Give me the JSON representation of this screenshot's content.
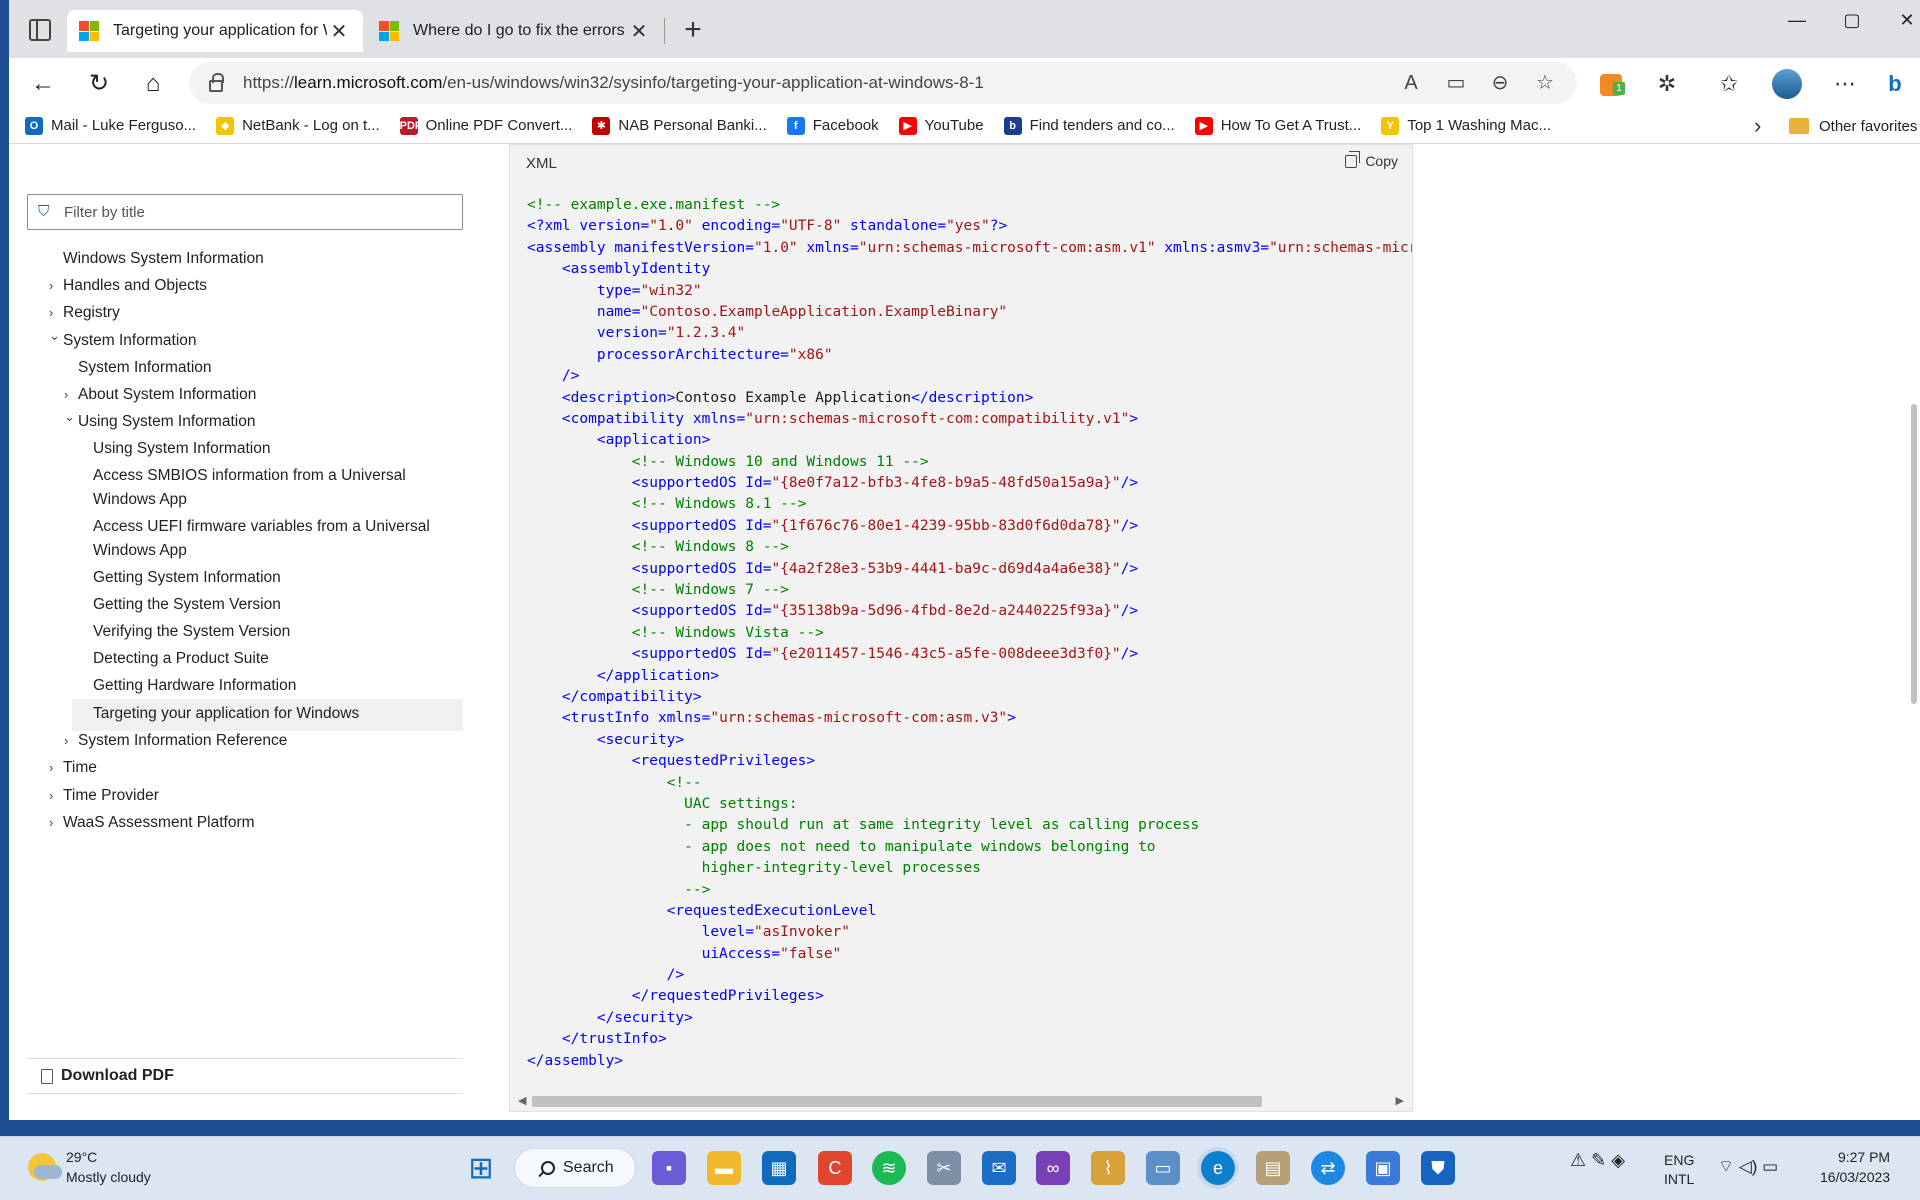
{
  "browser": {
    "tabs": [
      {
        "title": "Targeting your application for Wi",
        "active": true
      },
      {
        "title": "Where do I go to fix the errors on",
        "active": false
      }
    ],
    "new_tab": "+",
    "window_controls": {
      "minimize": "—",
      "maximize": "▢",
      "close": "✕"
    },
    "url": {
      "scheme": "https://",
      "host": "learn.microsoft.com",
      "path": "/en-us/windows/win32/sysinfo/targeting-your-application-at-windows-8-1"
    },
    "extension_badge": "1"
  },
  "bookmarks": [
    {
      "label": "Mail - Luke Ferguso...",
      "icon": "outlook-icon",
      "color": "#0f6cbd",
      "glyph": "O"
    },
    {
      "label": "NetBank - Log on t...",
      "icon": "commbank-icon",
      "color": "#f5c400",
      "glyph": "◆"
    },
    {
      "label": "Online PDF Convert...",
      "icon": "pdf-icon",
      "color": "#c0182b",
      "glyph": "PDF"
    },
    {
      "label": "NAB Personal Banki...",
      "icon": "nab-icon",
      "color": "#c20000",
      "glyph": "✱"
    },
    {
      "label": "Facebook",
      "icon": "facebook-icon",
      "color": "#1877f2",
      "glyph": "f"
    },
    {
      "label": "YouTube",
      "icon": "youtube-icon",
      "color": "#ff0000",
      "glyph": "▶"
    },
    {
      "label": "Find tenders and co...",
      "icon": "tenders-icon",
      "color": "#1a3d8f",
      "glyph": "b"
    },
    {
      "label": "How To Get A Trust...",
      "icon": "youtube-icon",
      "color": "#ff0000",
      "glyph": "▶"
    },
    {
      "label": "Top 1 Washing Mac...",
      "icon": "yellowpages-icon",
      "color": "#f2c500",
      "glyph": "Y"
    }
  ],
  "bookmarks_more": "›",
  "other_favorites": "Other favorites",
  "toc": {
    "filter_placeholder": "Filter by title",
    "items": [
      {
        "label": "Windows System Information",
        "level": 0,
        "chevron": ""
      },
      {
        "label": "Handles and Objects",
        "level": 0,
        "chevron": "›"
      },
      {
        "label": "Registry",
        "level": 0,
        "chevron": "›"
      },
      {
        "label": "System Information",
        "level": 0,
        "chevron": "⌄"
      },
      {
        "label": "System Information",
        "level": 1,
        "chevron": ""
      },
      {
        "label": "About System Information",
        "level": 1,
        "chevron": "›"
      },
      {
        "label": "Using System Information",
        "level": 1,
        "chevron": "⌄"
      },
      {
        "label": "Using System Information",
        "level": 2,
        "chevron": ""
      },
      {
        "label": "Access SMBIOS information from a Universal",
        "level": 2,
        "chevron": ""
      },
      {
        "label": "Windows App",
        "level": 2,
        "chevron": ""
      },
      {
        "label": "Access UEFI firmware variables from a Universal",
        "level": 2,
        "chevron": ""
      },
      {
        "label": "Windows App",
        "level": 2,
        "chevron": ""
      },
      {
        "label": "Getting System Information",
        "level": 2,
        "chevron": ""
      },
      {
        "label": "Getting the System Version",
        "level": 2,
        "chevron": ""
      },
      {
        "label": "Verifying the System Version",
        "level": 2,
        "chevron": ""
      },
      {
        "label": "Detecting a Product Suite",
        "level": 2,
        "chevron": ""
      },
      {
        "label": "Getting Hardware Information",
        "level": 2,
        "chevron": ""
      },
      {
        "label": "Targeting your application for Windows",
        "level": 2,
        "chevron": "",
        "selected": true
      },
      {
        "label": "System Information Reference",
        "level": 1,
        "chevron": "›"
      },
      {
        "label": "Time",
        "level": 0,
        "chevron": "›"
      },
      {
        "label": "Time Provider",
        "level": 0,
        "chevron": "›"
      },
      {
        "label": "WaaS Assessment Platform",
        "level": 0,
        "chevron": "›"
      }
    ],
    "download_pdf": "Download PDF"
  },
  "code_block": {
    "language": "XML",
    "copy_label": "Copy",
    "colors": {
      "comment": "#008000",
      "tag": "#0000ff",
      "attr": "#0000ff",
      "value": "#a31515",
      "text": "#1b1b1b"
    },
    "lines": [
      [
        [
          "c",
          "<!-- example.exe.manifest -->"
        ]
      ],
      [
        [
          "t",
          "<?xml "
        ],
        [
          "a",
          "version="
        ],
        [
          "v",
          "\"1.0\""
        ],
        [
          "a",
          " encoding="
        ],
        [
          "v",
          "\"UTF-8\""
        ],
        [
          "a",
          " standalone="
        ],
        [
          "v",
          "\"yes\""
        ],
        [
          "t",
          "?>"
        ]
      ],
      [
        [
          "t",
          "<assembly "
        ],
        [
          "a",
          "manifestVersion="
        ],
        [
          "v",
          "\"1.0\""
        ],
        [
          "a",
          " xmlns="
        ],
        [
          "v",
          "\"urn:schemas-microsoft-com:asm.v1\""
        ],
        [
          "a",
          " xmlns:asmv3="
        ],
        [
          "v",
          "\"urn:schemas-micr"
        ]
      ],
      [
        [
          "t",
          "    <assemblyIdentity"
        ]
      ],
      [
        [
          "a",
          "        type="
        ],
        [
          "v",
          "\"win32\""
        ]
      ],
      [
        [
          "a",
          "        name="
        ],
        [
          "v",
          "\"Contoso.ExampleApplication.ExampleBinary\""
        ]
      ],
      [
        [
          "a",
          "        version="
        ],
        [
          "v",
          "\"1.2.3.4\""
        ]
      ],
      [
        [
          "a",
          "        processorArchitecture="
        ],
        [
          "v",
          "\"x86\""
        ]
      ],
      [
        [
          "t",
          "    />"
        ]
      ],
      [
        [
          "t",
          "    <description>"
        ],
        [
          "x",
          "Contoso Example Application"
        ],
        [
          "t",
          "</description>"
        ]
      ],
      [
        [
          "t",
          "    <compatibility "
        ],
        [
          "a",
          "xmlns="
        ],
        [
          "v",
          "\"urn:schemas-microsoft-com:compatibility.v1\""
        ],
        [
          "t",
          ">"
        ]
      ],
      [
        [
          "t",
          "        <application>"
        ]
      ],
      [
        [
          "c",
          "            <!-- Windows 10 and Windows 11 -->"
        ]
      ],
      [
        [
          "t",
          "            <supportedOS "
        ],
        [
          "a",
          "Id="
        ],
        [
          "v",
          "\"{8e0f7a12-bfb3-4fe8-b9a5-48fd50a15a9a}\""
        ],
        [
          "t",
          "/>"
        ]
      ],
      [
        [
          "c",
          "            <!-- Windows 8.1 -->"
        ]
      ],
      [
        [
          "t",
          "            <supportedOS "
        ],
        [
          "a",
          "Id="
        ],
        [
          "v",
          "\"{1f676c76-80e1-4239-95bb-83d0f6d0da78}\""
        ],
        [
          "t",
          "/>"
        ]
      ],
      [
        [
          "c",
          "            <!-- Windows 8 -->"
        ]
      ],
      [
        [
          "t",
          "            <supportedOS "
        ],
        [
          "a",
          "Id="
        ],
        [
          "v",
          "\"{4a2f28e3-53b9-4441-ba9c-d69d4a4a6e38}\""
        ],
        [
          "t",
          "/>"
        ]
      ],
      [
        [
          "c",
          "            <!-- Windows 7 -->"
        ]
      ],
      [
        [
          "t",
          "            <supportedOS "
        ],
        [
          "a",
          "Id="
        ],
        [
          "v",
          "\"{35138b9a-5d96-4fbd-8e2d-a2440225f93a}\""
        ],
        [
          "t",
          "/>"
        ]
      ],
      [
        [
          "c",
          "            <!-- Windows Vista -->"
        ]
      ],
      [
        [
          "t",
          "            <supportedOS "
        ],
        [
          "a",
          "Id="
        ],
        [
          "v",
          "\"{e2011457-1546-43c5-a5fe-008deee3d3f0}\""
        ],
        [
          "t",
          "/>"
        ]
      ],
      [
        [
          "t",
          "        </application>"
        ]
      ],
      [
        [
          "t",
          "    </compatibility>"
        ]
      ],
      [
        [
          "t",
          "    <trustInfo "
        ],
        [
          "a",
          "xmlns="
        ],
        [
          "v",
          "\"urn:schemas-microsoft-com:asm.v3\""
        ],
        [
          "t",
          ">"
        ]
      ],
      [
        [
          "t",
          "        <security>"
        ]
      ],
      [
        [
          "t",
          "            <requestedPrivileges>"
        ]
      ],
      [
        [
          "c",
          "                <!--"
        ]
      ],
      [
        [
          "c",
          "                  UAC settings:"
        ]
      ],
      [
        [
          "c",
          "                  - app should run at same integrity level as calling process"
        ]
      ],
      [
        [
          "c",
          "                  - app does not need to manipulate windows belonging to"
        ]
      ],
      [
        [
          "c",
          "                    higher-integrity-level processes"
        ]
      ],
      [
        [
          "c",
          "                  -->"
        ]
      ],
      [
        [
          "t",
          "                <requestedExecutionLevel"
        ]
      ],
      [
        [
          "a",
          "                    level="
        ],
        [
          "v",
          "\"asInvoker\""
        ]
      ],
      [
        [
          "a",
          "                    uiAccess="
        ],
        [
          "v",
          "\"false\""
        ]
      ],
      [
        [
          "t",
          "                />"
        ]
      ],
      [
        [
          "t",
          "            </requestedPrivileges>"
        ]
      ],
      [
        [
          "t",
          "        </security>"
        ]
      ],
      [
        [
          "t",
          "    </trustInfo>"
        ]
      ],
      [
        [
          "t",
          "</assembly>"
        ]
      ]
    ]
  },
  "taskbar": {
    "weather": {
      "temp": "29°C",
      "condition": "Mostly cloudy"
    },
    "search_label": "Search",
    "language": {
      "line1": "ENG",
      "line2": "INTL"
    },
    "clock": {
      "time": "9:27 PM",
      "date": "16/03/2023"
    }
  }
}
